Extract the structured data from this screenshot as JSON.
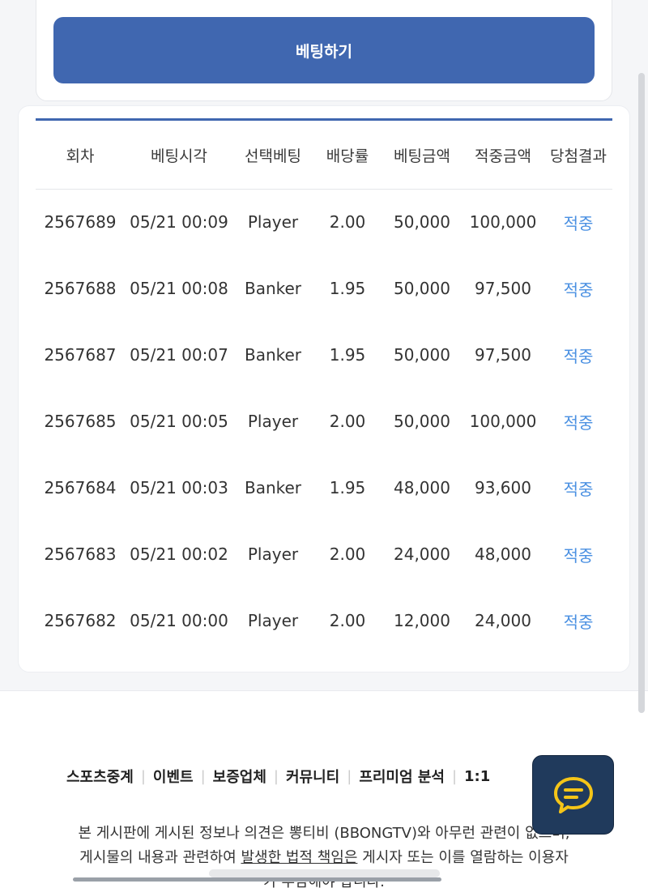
{
  "bet_button_label": "베팅하기",
  "history": {
    "columns": [
      "회차",
      "베팅시각",
      "선택베팅",
      "배당률",
      "베팅금액",
      "적중금액",
      "당첨결과"
    ],
    "rows": [
      {
        "round": "2567689",
        "time": "05/21 00:09",
        "choice": "Player",
        "odds": "2.00",
        "bet": "50,000",
        "payout": "100,000",
        "result": "적중"
      },
      {
        "round": "2567688",
        "time": "05/21 00:08",
        "choice": "Banker",
        "odds": "1.95",
        "bet": "50,000",
        "payout": "97,500",
        "result": "적중"
      },
      {
        "round": "2567687",
        "time": "05/21 00:07",
        "choice": "Banker",
        "odds": "1.95",
        "bet": "50,000",
        "payout": "97,500",
        "result": "적중"
      },
      {
        "round": "2567685",
        "time": "05/21 00:05",
        "choice": "Player",
        "odds": "2.00",
        "bet": "50,000",
        "payout": "100,000",
        "result": "적중"
      },
      {
        "round": "2567684",
        "time": "05/21 00:03",
        "choice": "Banker",
        "odds": "1.95",
        "bet": "48,000",
        "payout": "93,600",
        "result": "적중"
      },
      {
        "round": "2567683",
        "time": "05/21 00:02",
        "choice": "Player",
        "odds": "2.00",
        "bet": "24,000",
        "payout": "48,000",
        "result": "적중"
      },
      {
        "round": "2567682",
        "time": "05/21 00:00",
        "choice": "Player",
        "odds": "2.00",
        "bet": "12,000",
        "payout": "24,000",
        "result": "적중"
      }
    ]
  },
  "footer": {
    "nav": [
      "스포츠중계",
      "이벤트",
      "보증업체",
      "커뮤니티",
      "프리미엄 분석",
      "1:1"
    ],
    "disclaimer_line1": "본 게시판에 게시된 정보나 의견은 뽕티비 (BBONGTV)와 아무런 관련이 없으며,",
    "disclaimer_line2a": "게시물의 내용과 관련하여 ",
    "disclaimer_line2b": "발생한 법적 책임은",
    "disclaimer_line2c": " 게시자 또는 이를 열람하는 이용자",
    "disclaimer_line3": "가 부담해야 합니다."
  },
  "chat_icon": "chat-bubble-icon",
  "colors": {
    "primary": "#4067b0",
    "win": "#4a90e2",
    "fab": "#203a5c",
    "fab_icon": "#f5c518"
  }
}
